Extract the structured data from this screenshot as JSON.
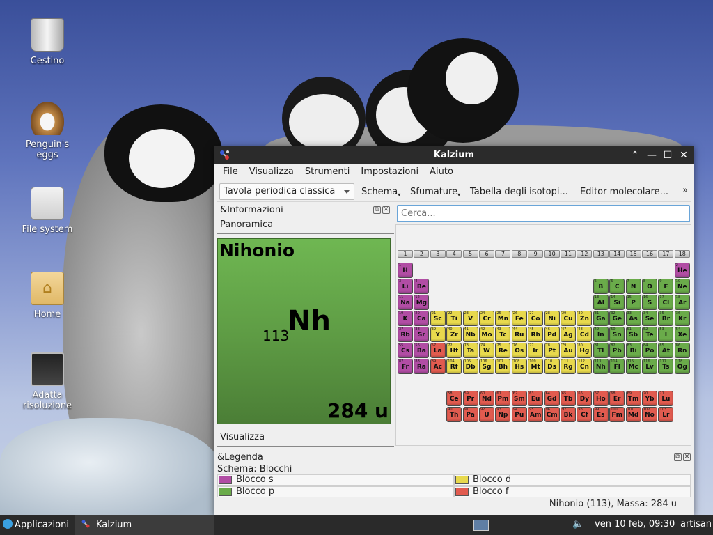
{
  "desktop": {
    "icons": [
      {
        "label": "Cestino"
      },
      {
        "label": "Penguin's eggs"
      },
      {
        "label": "File system"
      },
      {
        "label": "Home"
      },
      {
        "label": "Adatta risoluzione"
      }
    ]
  },
  "window": {
    "title": "Kalzium",
    "controls": {
      "shade": "⌃",
      "minimize": "—",
      "maximize": "☐",
      "close": "✕"
    }
  },
  "menu": {
    "items": [
      "File",
      "Visualizza",
      "Strumenti",
      "Impostazioni",
      "Aiuto"
    ]
  },
  "toolbar": {
    "table_select": "Tavola periodica classica",
    "schema": "Schema",
    "gradients": "Sfumature",
    "isotopes": "Tabella degli isotopi...",
    "molecular_editor": "Editor molecolare...",
    "more": "»"
  },
  "info_panel": {
    "title": "&Informazioni",
    "tab_overview": "Panoramica",
    "tab_view": "Visualizza",
    "element": {
      "name": "Nihonio",
      "number": "113",
      "symbol": "Nh",
      "mass": "284 u"
    },
    "color": "#5f9d45"
  },
  "search": {
    "placeholder": "Cerca..."
  },
  "groups": [
    "1",
    "2",
    "3",
    "4",
    "5",
    "6",
    "7",
    "8",
    "9",
    "10",
    "11",
    "12",
    "13",
    "14",
    "15",
    "16",
    "17",
    "18"
  ],
  "colors": {
    "s": "#b14da4",
    "p": "#6aab4a",
    "d": "#e8d94d",
    "f": "#e15b4f"
  },
  "elements": [
    {
      "n": "1",
      "s": "H",
      "r": 1,
      "c": 1,
      "b": "s"
    },
    {
      "n": "2",
      "s": "He",
      "r": 1,
      "c": 18,
      "b": "s"
    },
    {
      "n": "3",
      "s": "Li",
      "r": 2,
      "c": 1,
      "b": "s"
    },
    {
      "n": "4",
      "s": "Be",
      "r": 2,
      "c": 2,
      "b": "s"
    },
    {
      "n": "5",
      "s": "B",
      "r": 2,
      "c": 13,
      "b": "p"
    },
    {
      "n": "6",
      "s": "C",
      "r": 2,
      "c": 14,
      "b": "p"
    },
    {
      "n": "7",
      "s": "N",
      "r": 2,
      "c": 15,
      "b": "p"
    },
    {
      "n": "8",
      "s": "O",
      "r": 2,
      "c": 16,
      "b": "p"
    },
    {
      "n": "9",
      "s": "F",
      "r": 2,
      "c": 17,
      "b": "p"
    },
    {
      "n": "10",
      "s": "Ne",
      "r": 2,
      "c": 18,
      "b": "p"
    },
    {
      "n": "11",
      "s": "Na",
      "r": 3,
      "c": 1,
      "b": "s"
    },
    {
      "n": "12",
      "s": "Mg",
      "r": 3,
      "c": 2,
      "b": "s"
    },
    {
      "n": "13",
      "s": "Al",
      "r": 3,
      "c": 13,
      "b": "p"
    },
    {
      "n": "14",
      "s": "Si",
      "r": 3,
      "c": 14,
      "b": "p"
    },
    {
      "n": "15",
      "s": "P",
      "r": 3,
      "c": 15,
      "b": "p"
    },
    {
      "n": "16",
      "s": "S",
      "r": 3,
      "c": 16,
      "b": "p"
    },
    {
      "n": "17",
      "s": "Cl",
      "r": 3,
      "c": 17,
      "b": "p"
    },
    {
      "n": "18",
      "s": "Ar",
      "r": 3,
      "c": 18,
      "b": "p"
    },
    {
      "n": "19",
      "s": "K",
      "r": 4,
      "c": 1,
      "b": "s"
    },
    {
      "n": "20",
      "s": "Ca",
      "r": 4,
      "c": 2,
      "b": "s"
    },
    {
      "n": "21",
      "s": "Sc",
      "r": 4,
      "c": 3,
      "b": "d"
    },
    {
      "n": "22",
      "s": "Ti",
      "r": 4,
      "c": 4,
      "b": "d"
    },
    {
      "n": "23",
      "s": "V",
      "r": 4,
      "c": 5,
      "b": "d"
    },
    {
      "n": "24",
      "s": "Cr",
      "r": 4,
      "c": 6,
      "b": "d"
    },
    {
      "n": "25",
      "s": "Mn",
      "r": 4,
      "c": 7,
      "b": "d"
    },
    {
      "n": "26",
      "s": "Fe",
      "r": 4,
      "c": 8,
      "b": "d"
    },
    {
      "n": "27",
      "s": "Co",
      "r": 4,
      "c": 9,
      "b": "d"
    },
    {
      "n": "28",
      "s": "Ni",
      "r": 4,
      "c": 10,
      "b": "d"
    },
    {
      "n": "29",
      "s": "Cu",
      "r": 4,
      "c": 11,
      "b": "d"
    },
    {
      "n": "30",
      "s": "Zn",
      "r": 4,
      "c": 12,
      "b": "d"
    },
    {
      "n": "31",
      "s": "Ga",
      "r": 4,
      "c": 13,
      "b": "p"
    },
    {
      "n": "32",
      "s": "Ge",
      "r": 4,
      "c": 14,
      "b": "p"
    },
    {
      "n": "33",
      "s": "As",
      "r": 4,
      "c": 15,
      "b": "p"
    },
    {
      "n": "34",
      "s": "Se",
      "r": 4,
      "c": 16,
      "b": "p"
    },
    {
      "n": "35",
      "s": "Br",
      "r": 4,
      "c": 17,
      "b": "p"
    },
    {
      "n": "36",
      "s": "Kr",
      "r": 4,
      "c": 18,
      "b": "p"
    },
    {
      "n": "37",
      "s": "Rb",
      "r": 5,
      "c": 1,
      "b": "s"
    },
    {
      "n": "38",
      "s": "Sr",
      "r": 5,
      "c": 2,
      "b": "s"
    },
    {
      "n": "39",
      "s": "Y",
      "r": 5,
      "c": 3,
      "b": "d"
    },
    {
      "n": "40",
      "s": "Zr",
      "r": 5,
      "c": 4,
      "b": "d"
    },
    {
      "n": "41",
      "s": "Nb",
      "r": 5,
      "c": 5,
      "b": "d"
    },
    {
      "n": "42",
      "s": "Mo",
      "r": 5,
      "c": 6,
      "b": "d"
    },
    {
      "n": "43",
      "s": "Tc",
      "r": 5,
      "c": 7,
      "b": "d"
    },
    {
      "n": "44",
      "s": "Ru",
      "r": 5,
      "c": 8,
      "b": "d"
    },
    {
      "n": "45",
      "s": "Rh",
      "r": 5,
      "c": 9,
      "b": "d"
    },
    {
      "n": "46",
      "s": "Pd",
      "r": 5,
      "c": 10,
      "b": "d"
    },
    {
      "n": "47",
      "s": "Ag",
      "r": 5,
      "c": 11,
      "b": "d"
    },
    {
      "n": "48",
      "s": "Cd",
      "r": 5,
      "c": 12,
      "b": "d"
    },
    {
      "n": "49",
      "s": "In",
      "r": 5,
      "c": 13,
      "b": "p"
    },
    {
      "n": "50",
      "s": "Sn",
      "r": 5,
      "c": 14,
      "b": "p"
    },
    {
      "n": "51",
      "s": "Sb",
      "r": 5,
      "c": 15,
      "b": "p"
    },
    {
      "n": "52",
      "s": "Te",
      "r": 5,
      "c": 16,
      "b": "p"
    },
    {
      "n": "53",
      "s": "I",
      "r": 5,
      "c": 17,
      "b": "p"
    },
    {
      "n": "54",
      "s": "Xe",
      "r": 5,
      "c": 18,
      "b": "p"
    },
    {
      "n": "55",
      "s": "Cs",
      "r": 6,
      "c": 1,
      "b": "s"
    },
    {
      "n": "56",
      "s": "Ba",
      "r": 6,
      "c": 2,
      "b": "s"
    },
    {
      "n": "57",
      "s": "La",
      "r": 6,
      "c": 3,
      "b": "f"
    },
    {
      "n": "72",
      "s": "Hf",
      "r": 6,
      "c": 4,
      "b": "d"
    },
    {
      "n": "73",
      "s": "Ta",
      "r": 6,
      "c": 5,
      "b": "d"
    },
    {
      "n": "74",
      "s": "W",
      "r": 6,
      "c": 6,
      "b": "d"
    },
    {
      "n": "75",
      "s": "Re",
      "r": 6,
      "c": 7,
      "b": "d"
    },
    {
      "n": "76",
      "s": "Os",
      "r": 6,
      "c": 8,
      "b": "d"
    },
    {
      "n": "77",
      "s": "Ir",
      "r": 6,
      "c": 9,
      "b": "d"
    },
    {
      "n": "78",
      "s": "Pt",
      "r": 6,
      "c": 10,
      "b": "d"
    },
    {
      "n": "79",
      "s": "Au",
      "r": 6,
      "c": 11,
      "b": "d"
    },
    {
      "n": "80",
      "s": "Hg",
      "r": 6,
      "c": 12,
      "b": "d"
    },
    {
      "n": "81",
      "s": "Tl",
      "r": 6,
      "c": 13,
      "b": "p"
    },
    {
      "n": "82",
      "s": "Pb",
      "r": 6,
      "c": 14,
      "b": "p"
    },
    {
      "n": "83",
      "s": "Bi",
      "r": 6,
      "c": 15,
      "b": "p"
    },
    {
      "n": "84",
      "s": "Po",
      "r": 6,
      "c": 16,
      "b": "p"
    },
    {
      "n": "85",
      "s": "At",
      "r": 6,
      "c": 17,
      "b": "p"
    },
    {
      "n": "86",
      "s": "Rn",
      "r": 6,
      "c": 18,
      "b": "p"
    },
    {
      "n": "87",
      "s": "Fr",
      "r": 7,
      "c": 1,
      "b": "s"
    },
    {
      "n": "88",
      "s": "Ra",
      "r": 7,
      "c": 2,
      "b": "s"
    },
    {
      "n": "89",
      "s": "Ac",
      "r": 7,
      "c": 3,
      "b": "f"
    },
    {
      "n": "104",
      "s": "Rf",
      "r": 7,
      "c": 4,
      "b": "d"
    },
    {
      "n": "105",
      "s": "Db",
      "r": 7,
      "c": 5,
      "b": "d"
    },
    {
      "n": "106",
      "s": "Sg",
      "r": 7,
      "c": 6,
      "b": "d"
    },
    {
      "n": "107",
      "s": "Bh",
      "r": 7,
      "c": 7,
      "b": "d"
    },
    {
      "n": "108",
      "s": "Hs",
      "r": 7,
      "c": 8,
      "b": "d"
    },
    {
      "n": "109",
      "s": "Mt",
      "r": 7,
      "c": 9,
      "b": "d"
    },
    {
      "n": "110",
      "s": "Ds",
      "r": 7,
      "c": 10,
      "b": "d"
    },
    {
      "n": "111",
      "s": "Rg",
      "r": 7,
      "c": 11,
      "b": "d"
    },
    {
      "n": "112",
      "s": "Cn",
      "r": 7,
      "c": 12,
      "b": "d"
    },
    {
      "n": "113",
      "s": "Nh",
      "r": 7,
      "c": 13,
      "b": "p"
    },
    {
      "n": "114",
      "s": "Fl",
      "r": 7,
      "c": 14,
      "b": "p"
    },
    {
      "n": "115",
      "s": "Mc",
      "r": 7,
      "c": 15,
      "b": "p"
    },
    {
      "n": "116",
      "s": "Lv",
      "r": 7,
      "c": 16,
      "b": "p"
    },
    {
      "n": "117",
      "s": "Ts",
      "r": 7,
      "c": 17,
      "b": "p"
    },
    {
      "n": "118",
      "s": "Og",
      "r": 7,
      "c": 18,
      "b": "p"
    },
    {
      "n": "58",
      "s": "Ce",
      "r": 9,
      "c": 4,
      "b": "f"
    },
    {
      "n": "59",
      "s": "Pr",
      "r": 9,
      "c": 5,
      "b": "f"
    },
    {
      "n": "60",
      "s": "Nd",
      "r": 9,
      "c": 6,
      "b": "f"
    },
    {
      "n": "61",
      "s": "Pm",
      "r": 9,
      "c": 7,
      "b": "f"
    },
    {
      "n": "62",
      "s": "Sm",
      "r": 9,
      "c": 8,
      "b": "f"
    },
    {
      "n": "63",
      "s": "Eu",
      "r": 9,
      "c": 9,
      "b": "f"
    },
    {
      "n": "64",
      "s": "Gd",
      "r": 9,
      "c": 10,
      "b": "f"
    },
    {
      "n": "65",
      "s": "Tb",
      "r": 9,
      "c": 11,
      "b": "f"
    },
    {
      "n": "66",
      "s": "Dy",
      "r": 9,
      "c": 12,
      "b": "f"
    },
    {
      "n": "67",
      "s": "Ho",
      "r": 9,
      "c": 13,
      "b": "f"
    },
    {
      "n": "68",
      "s": "Er",
      "r": 9,
      "c": 14,
      "b": "f"
    },
    {
      "n": "69",
      "s": "Tm",
      "r": 9,
      "c": 15,
      "b": "f"
    },
    {
      "n": "70",
      "s": "Yb",
      "r": 9,
      "c": 16,
      "b": "f"
    },
    {
      "n": "71",
      "s": "Lu",
      "r": 9,
      "c": 17,
      "b": "f"
    },
    {
      "n": "90",
      "s": "Th",
      "r": 10,
      "c": 4,
      "b": "f"
    },
    {
      "n": "91",
      "s": "Pa",
      "r": 10,
      "c": 5,
      "b": "f"
    },
    {
      "n": "92",
      "s": "U",
      "r": 10,
      "c": 6,
      "b": "f"
    },
    {
      "n": "93",
      "s": "Np",
      "r": 10,
      "c": 7,
      "b": "f"
    },
    {
      "n": "94",
      "s": "Pu",
      "r": 10,
      "c": 8,
      "b": "f"
    },
    {
      "n": "95",
      "s": "Am",
      "r": 10,
      "c": 9,
      "b": "f"
    },
    {
      "n": "96",
      "s": "Cm",
      "r": 10,
      "c": 10,
      "b": "f"
    },
    {
      "n": "97",
      "s": "Bk",
      "r": 10,
      "c": 11,
      "b": "f"
    },
    {
      "n": "98",
      "s": "Cf",
      "r": 10,
      "c": 12,
      "b": "f"
    },
    {
      "n": "99",
      "s": "Es",
      "r": 10,
      "c": 13,
      "b": "f"
    },
    {
      "n": "100",
      "s": "Fm",
      "r": 10,
      "c": 14,
      "b": "f"
    },
    {
      "n": "101",
      "s": "Md",
      "r": 10,
      "c": 15,
      "b": "f"
    },
    {
      "n": "102",
      "s": "No",
      "r": 10,
      "c": 16,
      "b": "f"
    },
    {
      "n": "103",
      "s": "Lr",
      "r": 10,
      "c": 17,
      "b": "f"
    }
  ],
  "legend": {
    "title": "&Legenda",
    "scheme": "Schema: Blocchi",
    "items": [
      "Blocco s",
      "Blocco d",
      "Blocco p",
      "Blocco f"
    ]
  },
  "status": "Nihonio (113), Massa: 284 u",
  "taskbar": {
    "apps": "Applicazioni",
    "task": "Kalzium",
    "clock": "ven 10 feb, 09:30",
    "user": "artisan"
  }
}
